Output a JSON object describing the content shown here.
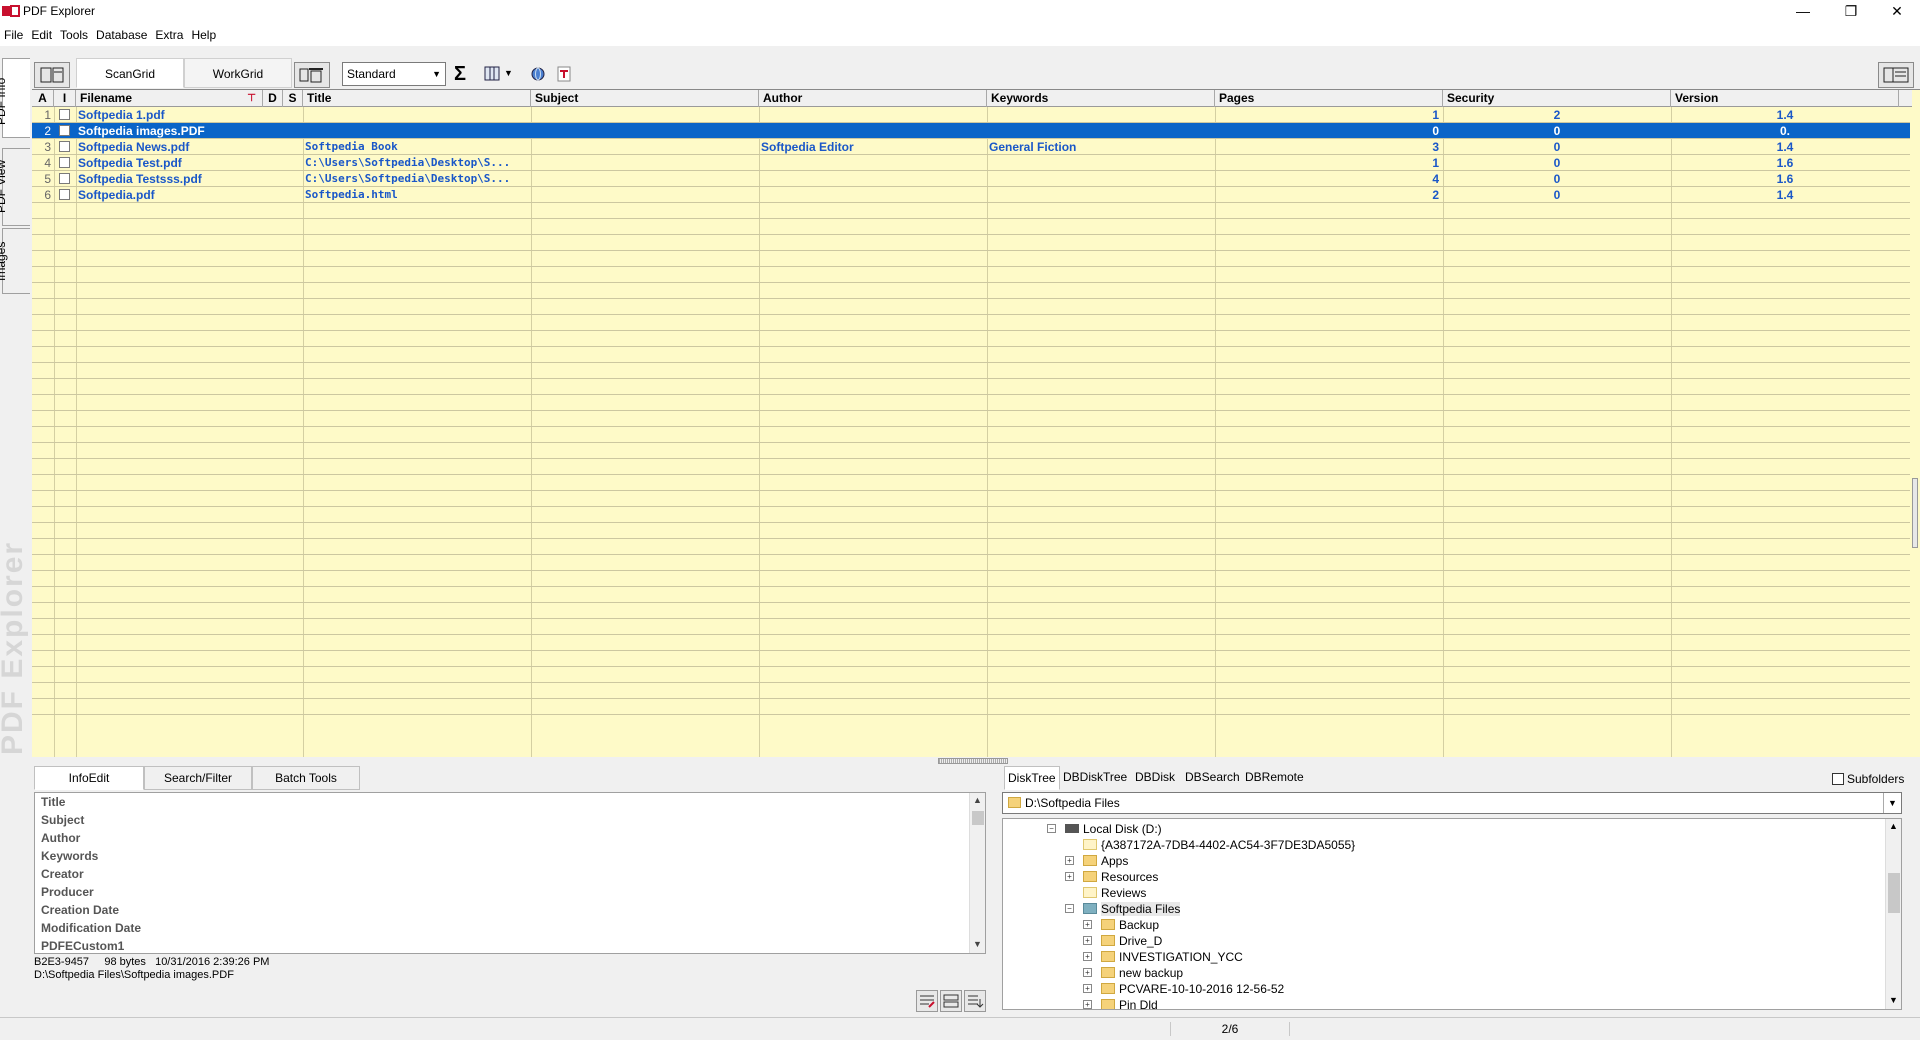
{
  "window": {
    "title": "PDF Explorer",
    "minimize_icon": "minimize-icon",
    "restore_icon": "restore-icon",
    "close_icon": "close-icon"
  },
  "menu": [
    "File",
    "Edit",
    "Tools",
    "Database",
    "Extra",
    "Help"
  ],
  "side_tabs": [
    "PDF Info",
    "PDF View",
    "Images"
  ],
  "watermark": "PDF Explorer",
  "toolbar": {
    "tabs": [
      "ScanGrid",
      "WorkGrid"
    ],
    "view_select": "Standard",
    "sum_icon": "Σ"
  },
  "grid": {
    "columns": [
      "A",
      "I",
      "Filename",
      "D",
      "S",
      "Title",
      "Subject",
      "Author",
      "Keywords",
      "Pages",
      "Security",
      "Version"
    ],
    "rows": [
      {
        "num": "1",
        "filename": "Softpedia 1.pdf",
        "title": "",
        "subject": "",
        "author": "",
        "keywords": "",
        "pages": "1",
        "security": "2",
        "version": "1.4"
      },
      {
        "num": "2",
        "filename": "Softpedia images.PDF",
        "title": "",
        "subject": "",
        "author": "",
        "keywords": "",
        "pages": "0",
        "security": "0",
        "version": "0."
      },
      {
        "num": "3",
        "filename": "Softpedia News.pdf",
        "title": "Softpedia Book",
        "subject": "",
        "author": "Softpedia Editor",
        "keywords": "General Fiction",
        "pages": "3",
        "security": "0",
        "version": "1.4"
      },
      {
        "num": "4",
        "filename": "Softpedia Test.pdf",
        "title": "C:\\Users\\Softpedia\\Desktop\\S...",
        "subject": "",
        "author": "",
        "keywords": "",
        "pages": "1",
        "security": "0",
        "version": "1.6"
      },
      {
        "num": "5",
        "filename": "Softpedia Testsss.pdf",
        "title": "C:\\Users\\Softpedia\\Desktop\\S...",
        "subject": "",
        "author": "",
        "keywords": "",
        "pages": "4",
        "security": "0",
        "version": "1.6"
      },
      {
        "num": "6",
        "filename": "Softpedia.pdf",
        "title": "Softpedia.html",
        "subject": "",
        "author": "",
        "keywords": "",
        "pages": "2",
        "security": "0",
        "version": "1.4"
      }
    ],
    "selected_row": 2
  },
  "info_panel": {
    "tabs": [
      "InfoEdit",
      "Search/Filter",
      "Batch Tools"
    ],
    "fields": [
      "Title",
      "Subject",
      "Author",
      "Keywords",
      "Creator",
      "Producer",
      "Creation Date",
      "Modification Date",
      "PDFECustom1"
    ],
    "status_line1": "B2E3-9457     98 bytes   10/31/2016 2:39:26 PM",
    "status_line2": "D:\\Softpedia Files\\Softpedia images.PDF"
  },
  "tree_panel": {
    "tabs": [
      "DiskTree",
      "DBDiskTree",
      "DBDisk",
      "DBSearch",
      "DBRemote"
    ],
    "subfolders_label": "Subfolders",
    "subfolders_checked": false,
    "path": "D:\\Softpedia Files",
    "nodes": [
      {
        "label": "Local Disk (D:)",
        "type": "drive",
        "level": 0,
        "expander": "−"
      },
      {
        "label": "{A387172A-7DB4-4402-AC54-3F7DE3DA5055}",
        "type": "blank",
        "level": 1,
        "expander": ""
      },
      {
        "label": "Apps",
        "type": "folder",
        "level": 1,
        "expander": "+"
      },
      {
        "label": "Resources",
        "type": "folder",
        "level": 1,
        "expander": "+"
      },
      {
        "label": "Reviews",
        "type": "blank",
        "level": 1,
        "expander": ""
      },
      {
        "label": "Softpedia Files",
        "type": "selected",
        "level": 1,
        "expander": "−"
      },
      {
        "label": "Backup",
        "type": "folder",
        "level": 2,
        "expander": "+"
      },
      {
        "label": "Drive_D",
        "type": "folder",
        "level": 2,
        "expander": "+"
      },
      {
        "label": "INVESTIGATION_YCC",
        "type": "folder",
        "level": 2,
        "expander": "+"
      },
      {
        "label": "new backup",
        "type": "folder",
        "level": 2,
        "expander": "+"
      },
      {
        "label": "PCVARE-10-10-2016 12-56-52",
        "type": "folder",
        "level": 2,
        "expander": "+"
      },
      {
        "label": "Pin Dld",
        "type": "folder",
        "level": 2,
        "expander": "+"
      }
    ]
  },
  "statusbar": {
    "page_count": "2/6"
  }
}
